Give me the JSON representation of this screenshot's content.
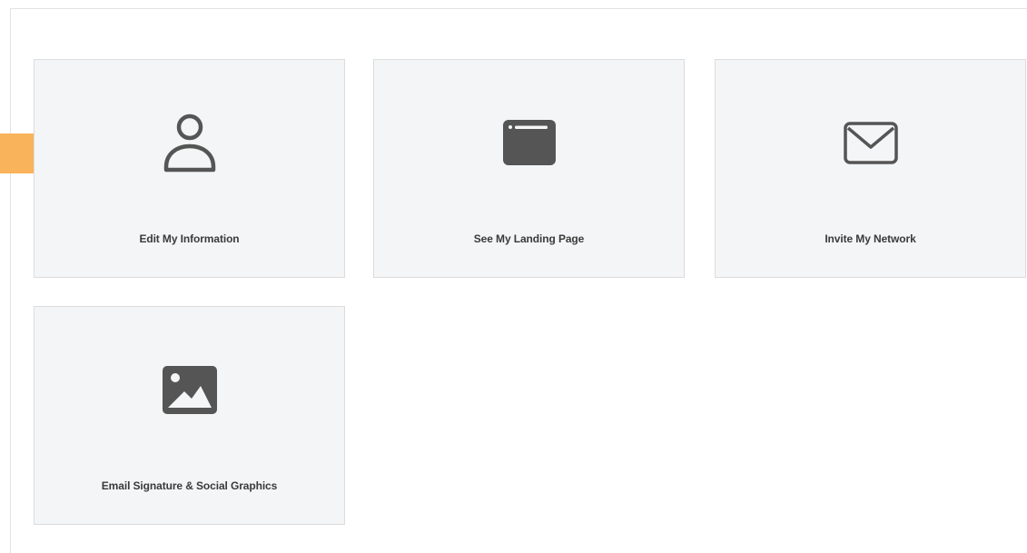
{
  "cards": [
    {
      "label": "Edit My Information",
      "icon": "user-icon"
    },
    {
      "label": "See My Landing Page",
      "icon": "browser-window-icon"
    },
    {
      "label": "Invite My Network",
      "icon": "envelope-icon"
    },
    {
      "label": "Email Signature & Social Graphics",
      "icon": "image-icon"
    }
  ],
  "colors": {
    "card_background": "#f4f5f6",
    "card_border": "#dcdcdc",
    "icon": "#555555",
    "arrow": "#f9b45b"
  }
}
